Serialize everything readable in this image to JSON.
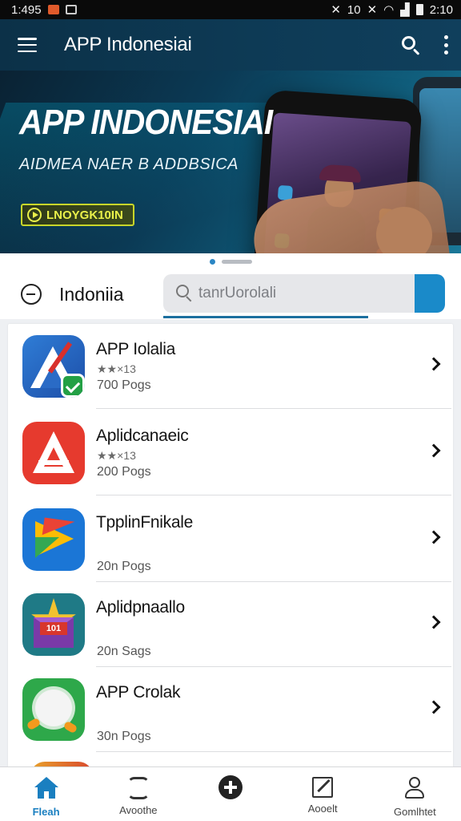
{
  "status_bar": {
    "time_left": "1:495",
    "signal_text": "10",
    "time_right": "2:10"
  },
  "app_bar": {
    "title": "APP Indonesiai",
    "icons": [
      "menu-icon",
      "search-icon",
      "more-vert-icon"
    ]
  },
  "banner": {
    "title": "APP INDONESIAI",
    "subtitle": "AIDMEA NAER B ADDBSICA",
    "cta_label": "LNOYGK10IN",
    "page_index": 1,
    "page_count": 2
  },
  "filter": {
    "label": "Indoniia",
    "search_placeholder": "tanrUorolali"
  },
  "apps": [
    {
      "name": "APP Iolalia",
      "rating": "★★×13",
      "meta": "700 Pogs",
      "icon": "app-a-check-icon"
    },
    {
      "name": "Aplidcanaeic",
      "rating": "★★×13",
      "meta": "200 Pogs",
      "icon": "red-a-icon"
    },
    {
      "name": "TpplinFnikale",
      "rating": "",
      "meta": "20n Pogs",
      "icon": "play-triangle-icon"
    },
    {
      "name": "Aplidpnaallo",
      "rating": "",
      "meta": "20n Sags",
      "icon": "star-envelope-icon"
    },
    {
      "name": "APP Crolak",
      "rating": "",
      "meta": "30n Pogs",
      "icon": "green-circle-icon"
    }
  ],
  "bottom_nav": [
    {
      "label": "Fleah",
      "icon": "home-icon",
      "active": true
    },
    {
      "label": "Avoothe",
      "icon": "sync-icon",
      "active": false
    },
    {
      "label": "",
      "icon": "add-circle-icon",
      "active": false
    },
    {
      "label": "Aooelt",
      "icon": "edit-icon",
      "active": false
    },
    {
      "label": "Gomlhtet",
      "icon": "user-icon",
      "active": false
    }
  ],
  "colors": {
    "primary": "#1a7fc0",
    "appbar": "#0c3148",
    "accent_cta": "#c8d62a"
  }
}
